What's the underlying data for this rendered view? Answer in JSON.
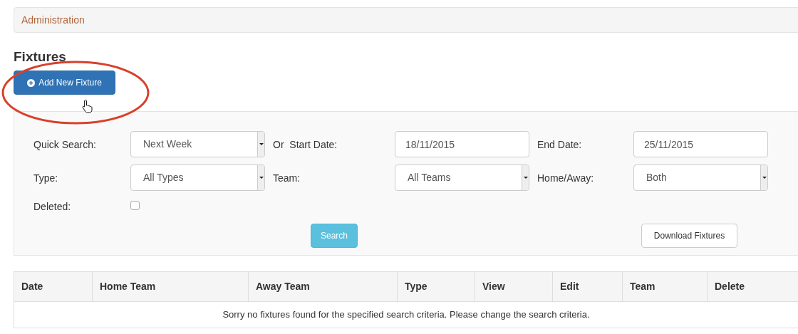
{
  "breadcrumb": {
    "label": "Administration"
  },
  "heading": "Fixtures",
  "add_button": {
    "label": "Add New Fixture"
  },
  "filters": {
    "rows": [
      [
        {
          "kind": "label",
          "text": "Quick Search:"
        },
        {
          "kind": "select",
          "value": "Next Week"
        },
        {
          "kind": "label",
          "text": "Or  Start Date:"
        },
        {
          "kind": "input",
          "value": "18/11/2015"
        },
        {
          "kind": "label",
          "text": "End Date:"
        },
        {
          "kind": "input",
          "value": "25/11/2015"
        }
      ],
      [
        {
          "kind": "label",
          "text": "Type:"
        },
        {
          "kind": "select",
          "value": "All Types"
        },
        {
          "kind": "label",
          "text": "Team:"
        },
        {
          "kind": "select",
          "value": "All Teams"
        },
        {
          "kind": "label",
          "text": "Home/Away:"
        },
        {
          "kind": "select",
          "value": "Both"
        }
      ],
      [
        {
          "kind": "label",
          "text": "Deleted:"
        },
        {
          "kind": "checkbox",
          "checked": false
        }
      ]
    ],
    "search_button": "Search",
    "download_button": "Download Fixtures"
  },
  "table": {
    "columns": [
      "Date",
      "Home Team",
      "Away Team",
      "Type",
      "View",
      "Edit",
      "Team",
      "Delete"
    ],
    "empty_message": "Sorry no fixtures found for the specified search criteria. Please change the search criteria."
  }
}
